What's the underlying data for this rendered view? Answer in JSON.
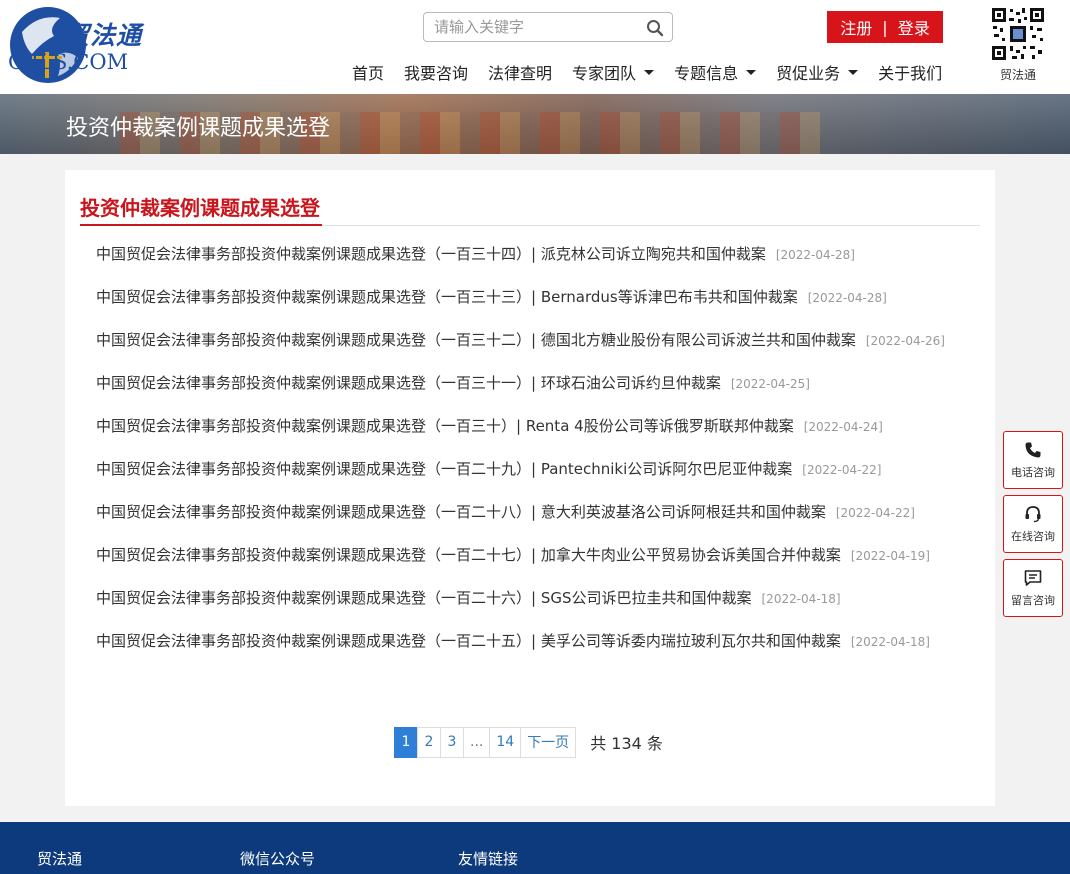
{
  "brand": {
    "name_cn": "贸法通",
    "name_en": "C ILS.COM",
    "colors": {
      "primary_red": "#d7141a",
      "primary_blue": "#1f4fa3",
      "footer_blue": "#0d3a7c",
      "active_page": "#2f7ed8"
    }
  },
  "header": {
    "search": {
      "placeholder": "请输入关键字",
      "icon": "search-icon"
    },
    "auth": {
      "register": "注册",
      "separator": "|",
      "login": "登录"
    },
    "qr_caption": "贸法通",
    "nav": [
      {
        "label": "首页",
        "dropdown": false
      },
      {
        "label": "我要咨询",
        "dropdown": false
      },
      {
        "label": "法律查明",
        "dropdown": false
      },
      {
        "label": "专家团队",
        "dropdown": true
      },
      {
        "label": "专题信息",
        "dropdown": true
      },
      {
        "label": "贸促业务",
        "dropdown": true
      },
      {
        "label": "关于我们",
        "dropdown": false
      }
    ]
  },
  "banner": {
    "title": "投资仲裁案例课题成果选登"
  },
  "content": {
    "section_title": "投资仲裁案例课题成果选登",
    "articles": [
      {
        "title": "中国贸促会法律事务部投资仲裁案例课题成果选登（一百三十四）| 派克林公司诉立陶宛共和国仲裁案",
        "date": "[2022-04-28]"
      },
      {
        "title": "中国贸促会法律事务部投资仲裁案例课题成果选登（一百三十三）| Bernardus等诉津巴布韦共和国仲裁案",
        "date": "[2022-04-28]"
      },
      {
        "title": "中国贸促会法律事务部投资仲裁案例课题成果选登（一百三十二）| 德国北方糖业股份有限公司诉波兰共和国仲裁案",
        "date": "[2022-04-26]"
      },
      {
        "title": "中国贸促会法律事务部投资仲裁案例课题成果选登（一百三十一）| 环球石油公司诉约旦仲裁案",
        "date": "[2022-04-25]"
      },
      {
        "title": "中国贸促会法律事务部投资仲裁案例课题成果选登（一百三十）| Renta 4股份公司等诉俄罗斯联邦仲裁案",
        "date": "[2022-04-24]"
      },
      {
        "title": "中国贸促会法律事务部投资仲裁案例课题成果选登（一百二十九）| Pantechniki公司诉阿尔巴尼亚仲裁案",
        "date": "[2022-04-22]"
      },
      {
        "title": "中国贸促会法律事务部投资仲裁案例课题成果选登（一百二十八）| 意大利英波基洛公司诉阿根廷共和国仲裁案",
        "date": "[2022-04-22]"
      },
      {
        "title": "中国贸促会法律事务部投资仲裁案例课题成果选登（一百二十七）| 加拿大牛肉业公平贸易协会诉美国合并仲裁案",
        "date": "[2022-04-19]"
      },
      {
        "title": "中国贸促会法律事务部投资仲裁案例课题成果选登（一百二十六）| SGS公司诉巴拉圭共和国仲裁案",
        "date": "[2022-04-18]"
      },
      {
        "title": "中国贸促会法律事务部投资仲裁案例课题成果选登（一百二十五）| 美孚公司等诉委内瑞拉玻利瓦尔共和国仲裁案",
        "date": "[2022-04-18]"
      }
    ],
    "pagination": {
      "pages": [
        "1",
        "2",
        "3",
        "...",
        "14"
      ],
      "current": "1",
      "next": "下一页",
      "total": "共 134 条"
    }
  },
  "float_bar": [
    {
      "label": "电话咨询",
      "icon": "phone-icon"
    },
    {
      "label": "在线咨询",
      "icon": "headset-icon"
    },
    {
      "label": "留言咨询",
      "icon": "message-icon"
    }
  ],
  "footer": {
    "columns": [
      "贸法通",
      "微信公众号",
      "友情链接"
    ]
  }
}
